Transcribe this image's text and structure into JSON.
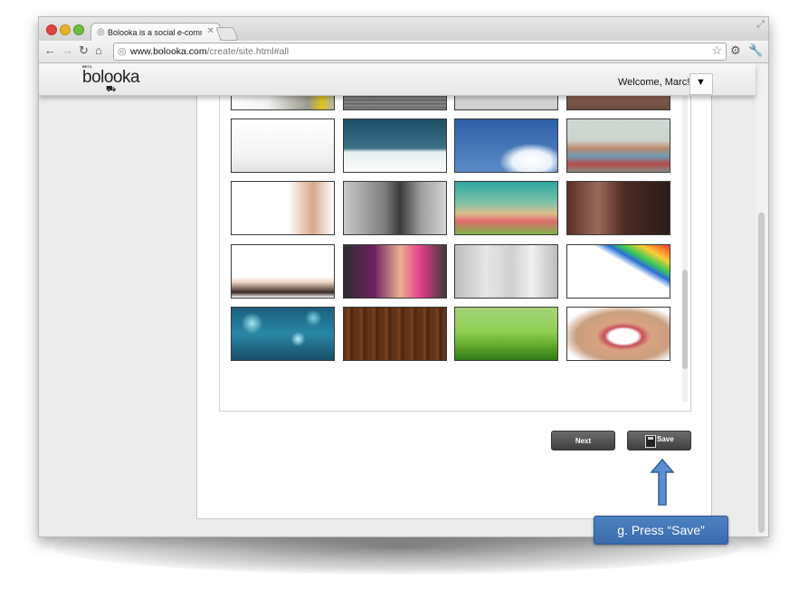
{
  "browser": {
    "tab_title": "Bolooka is a social e-comme",
    "url_host": "www.bolooka.com",
    "url_path": "/create/site.html#all"
  },
  "site": {
    "logo_beta": "BETA",
    "logo_text": "bolooka",
    "welcome_text": "Welcome, Marc!",
    "menu_glyph": "▼"
  },
  "thumbnails": [
    {
      "name": "thumb-hardhat",
      "bg": "linear-gradient(90deg,#ffffff 0%,#f3f3f3 35%,#b8b8ae 60%,#9a9a90 75%,#e0c21c 88%,#b5b5a8 100%)"
    },
    {
      "name": "thumb-shutter",
      "bg": "repeating-linear-gradient(180deg,#6c6c6c 0px,#8f8f8f 2px,#5a5a5a 4px)"
    },
    {
      "name": "thumb-house-tools",
      "bg": "linear-gradient(180deg,#f2f2f2 0%,#dedede 60%,#cfcfcf 100%)"
    },
    {
      "name": "thumb-pink-chairs",
      "bg": "linear-gradient(180deg,#7a5245 0%,#a27565 55%,#6a4a3c 100%)"
    },
    {
      "name": "thumb-lamp-sofa",
      "bg": "linear-gradient(180deg,#ffffff 0%,#f3f3f3 70%,#e2e2e2 100%)"
    },
    {
      "name": "thumb-blue-lounge",
      "bg": "linear-gradient(180deg,#1d4e63 0%,#3b7187 55%,#e6eef0 62%,#fbfbfb 100%)"
    },
    {
      "name": "thumb-cloud-sky",
      "bg": "radial-gradient(ellipse at 75% 80%,#ffffff 0%,#eaf2fb 18%,transparent 30%),linear-gradient(180deg,#2f5fa5 0%,#5a8cc8 100%)"
    },
    {
      "name": "thumb-town-houses",
      "bg": "linear-gradient(180deg,#cfd9d4 0%,#cbd3cc 40%,#bd8a6c 55%,#6e9bb2 70%,#b44b4b 85%,#8a8f86 100%)"
    },
    {
      "name": "thumb-baby",
      "bg": "linear-gradient(90deg,#ffffff 0%,#ffffff 55%,#e8c7b0 70%,#d5a98c 80%,#ffffff 100%)"
    },
    {
      "name": "thumb-fashion-women",
      "bg": "linear-gradient(90deg,#c9c9c9 0%,#7d7d7d 40%,#3a3a3a 55%,#9c9c9c 75%,#d4d4d4 100%)"
    },
    {
      "name": "thumb-retro-couple",
      "bg": "linear-gradient(180deg,#2fa6a0 0%,#7fc2a8 40%,#d9c08d 60%,#e06b6b 75%,#7db34a 100%)"
    },
    {
      "name": "thumb-shopping-legs",
      "bg": "linear-gradient(90deg,#5b2f28 0%,#9b6a5a 30%,#4e2d25 55%,#2c1c18 100%)"
    },
    {
      "name": "thumb-high-heels",
      "bg": "linear-gradient(180deg,#ffffff 0%,#ffffff 60%,#f1d7c6 70%,#3a2a25 90%,#ffffff 100%)"
    },
    {
      "name": "thumb-sunglasses-woman",
      "bg": "linear-gradient(90deg,#2e2e2e 0%,#6e2060 30%,#e8b18f 55%,#e63c8a 75%,#3a3a3a 100%)"
    },
    {
      "name": "thumb-brushed-metal",
      "bg": "linear-gradient(90deg,#bdbdbd 0%,#e6e6e6 30%,#d0d0d0 55%,#f0f0f0 75%,#bcbcbc 100%)"
    },
    {
      "name": "thumb-paint-splash",
      "bg": "linear-gradient(210deg,#ff3a2a 0%,#ffcc33 15%,#3acc55 25%,#2a6fd6 32%,#ffffff 40%,#ffffff 100%)"
    },
    {
      "name": "thumb-bokeh",
      "bg": "radial-gradient(circle at 20% 30%,#9fe6f0 0%,transparent 12%),radial-gradient(circle at 65% 60%,#bdf0ff 0%,transparent 10%),radial-gradient(circle at 80% 20%,#7fd2e3 0%,transparent 9%),linear-gradient(180deg,#1b5f7e 0%,#2a87a5 50%,#184d68 100%)"
    },
    {
      "name": "thumb-wood-planks",
      "bg": "repeating-linear-gradient(90deg,#5a2e15 0px,#7a4221 6px,#4a2410 8px,#6b3819 14px)"
    },
    {
      "name": "thumb-grass-bokeh",
      "bg": "linear-gradient(180deg,#a7d37a 0%,#8fcf55 45%,#5fa52a 75%,#2f7a1a 100%)"
    },
    {
      "name": "thumb-smile",
      "bg": "radial-gradient(ellipse at 55% 55%,#ffffff 0%,#ffffff 18%,#c94e5a 24%,#d9a282 34%,#caa07f 60%,#ffffff 80%)"
    }
  ],
  "actions": {
    "next_label": "Next",
    "save_label": "Save"
  },
  "callout": {
    "text": "g. Press “Save”"
  }
}
